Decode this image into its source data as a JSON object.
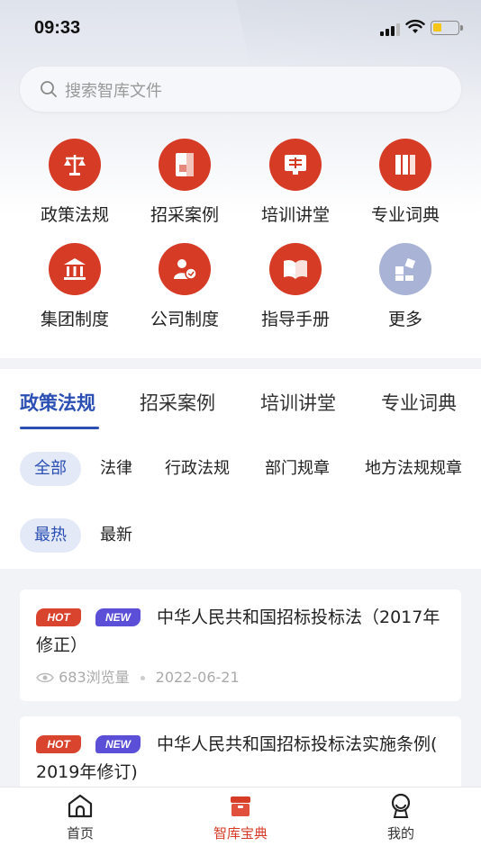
{
  "status": {
    "time": "09:33"
  },
  "search": {
    "placeholder": "搜索智库文件"
  },
  "grid": [
    {
      "label": "政策法规",
      "icon": "scale-icon"
    },
    {
      "label": "招采案例",
      "icon": "document-icon"
    },
    {
      "label": "培训讲堂",
      "icon": "lecture-icon"
    },
    {
      "label": "专业词典",
      "icon": "books-icon"
    },
    {
      "label": "集团制度",
      "icon": "bank-icon"
    },
    {
      "label": "公司制度",
      "icon": "user-settings-icon"
    },
    {
      "label": "指导手册",
      "icon": "open-book-icon"
    },
    {
      "label": "更多",
      "icon": "more-apps-icon"
    }
  ],
  "tabs": [
    "政策法规",
    "招采案例",
    "培训讲堂",
    "专业词典"
  ],
  "filters": {
    "types": [
      "全部",
      "法律",
      "行政法规",
      "部门规章",
      "地方法规规章"
    ],
    "sort": [
      "最热",
      "最新"
    ]
  },
  "cards": [
    {
      "hot": "HOT",
      "new": "NEW",
      "title_line1": "中华人民共和国招标投标法（2017年",
      "title_line2": "修正）",
      "views": "683浏览量",
      "date": "2022-06-21"
    },
    {
      "hot": "HOT",
      "new": "NEW",
      "title_line1": "中华人民共和国招标投标法实施条例(",
      "title_line2": "2019年修订)"
    }
  ],
  "nav": [
    "首页",
    "智库宝典",
    "我的"
  ],
  "colors": {
    "accent_red": "#d63b26",
    "accent_blue": "#2b4fb3",
    "more_icon_bg": "#a8b3d6"
  }
}
